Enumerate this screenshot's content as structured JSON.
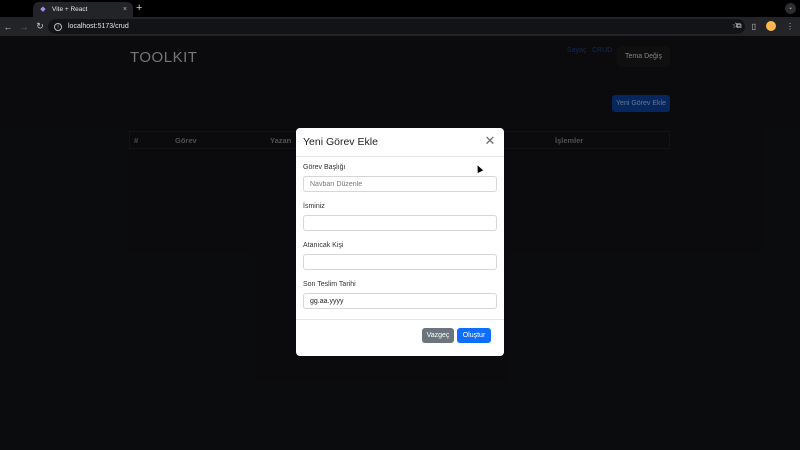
{
  "browser": {
    "tab_title": "Vite + React",
    "url": "localhost:5173/crud",
    "new_tab": "+",
    "tab_close": "×"
  },
  "header": {
    "brand": "TOOLKIT",
    "nav": [
      "Sayaç",
      "CRUD"
    ],
    "theme_button": "Tema Değiş"
  },
  "toolbar": {
    "add_task_button": "Yeni Görev Ekle"
  },
  "table": {
    "headers": [
      "#",
      "Görev",
      "Yazan",
      "İşlemler"
    ]
  },
  "modal": {
    "title": "Yeni Görev Ekle",
    "fields": [
      {
        "label": "Görev Başlığı",
        "value": "",
        "placeholder": "Navbarı Düzenle"
      },
      {
        "label": "İsminiz",
        "value": "",
        "placeholder": ""
      },
      {
        "label": "Atanıcak Kişi",
        "value": "",
        "placeholder": ""
      },
      {
        "label": "Son Teslim Tarihi",
        "value": "gg.aa.yyyy",
        "placeholder": ""
      }
    ],
    "cancel_button": "Vazgeç",
    "create_button": "Oluştur"
  },
  "colors": {
    "primary": "#0d6efd",
    "secondary": "#6c757d",
    "page_bg": "#111214"
  }
}
